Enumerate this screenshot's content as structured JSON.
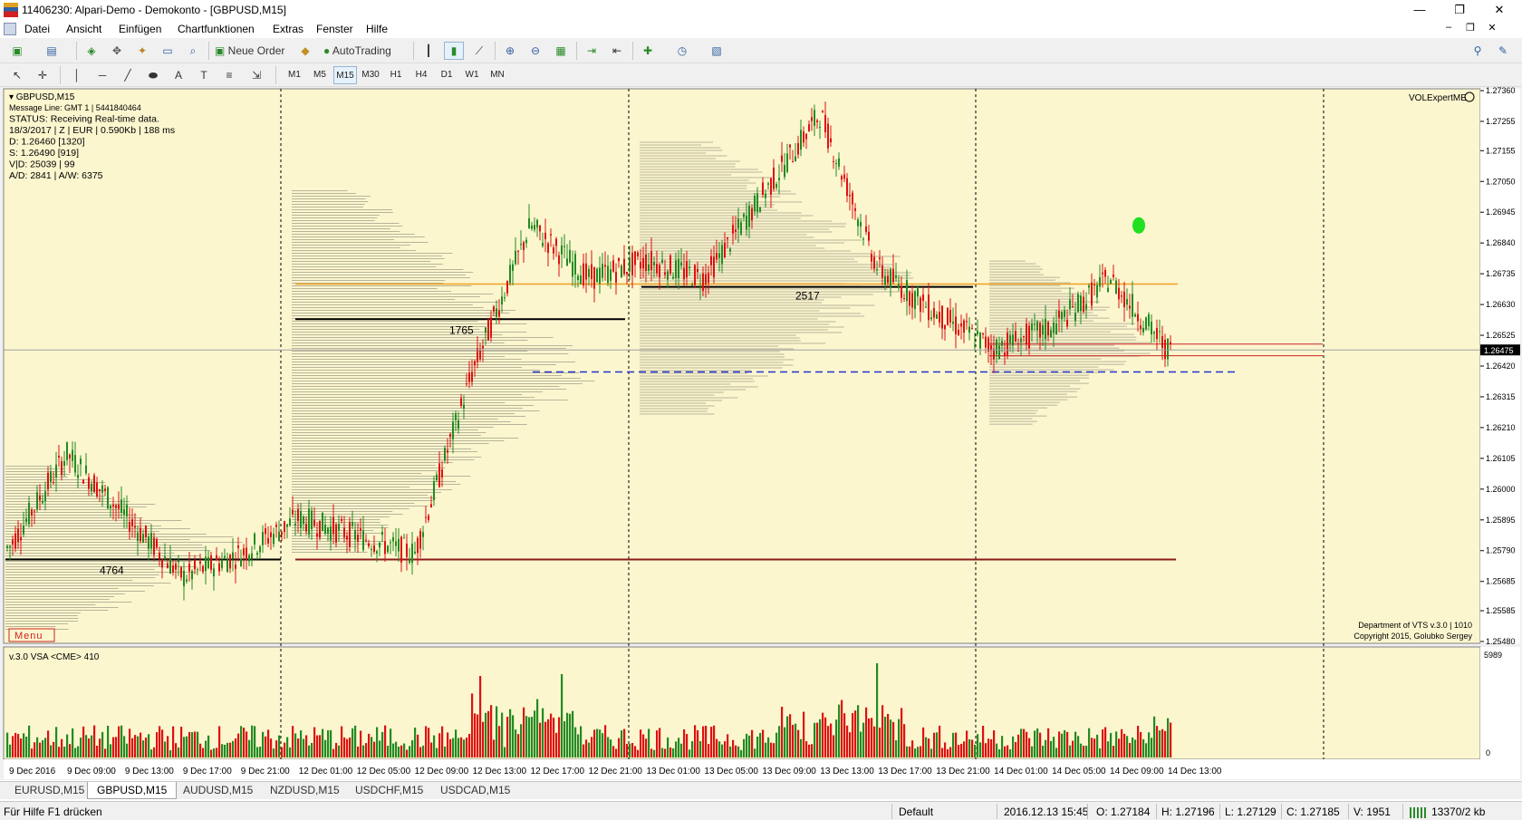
{
  "window": {
    "title": "11406230: Alpari-Demo - Demokonto - [GBPUSD,M15]",
    "minimize": "—",
    "restore": "❐",
    "close": "✕"
  },
  "menu": {
    "items": [
      "Datei",
      "Ansicht",
      "Einfügen",
      "Chartfunktionen",
      "Extras",
      "Fenster",
      "Hilfe"
    ],
    "child_min": "–",
    "child_restore": "❐",
    "child_close": "✕"
  },
  "toolbar": {
    "new_order_label": "Neue Order",
    "autotrading_label": "AutoTrading",
    "timeframes": [
      "M1",
      "M5",
      "M15",
      "M30",
      "H1",
      "H4",
      "D1",
      "W1",
      "MN"
    ],
    "selected_timeframe": "M15"
  },
  "chart": {
    "symbol_label": "▾ GBPUSD,M15",
    "info_lines": [
      "Message Line: GMT 1  |  5441840464",
      "STATUS:  Receiving Real-time data.",
      "18/3/2017 | Z | EUR | 0.590Kb | 188 ms",
      "D: 1.26460  [1320]",
      "S: 1.26490  [919]",
      "V|D: 25039 | 99",
      "A/D: 2841 | A/W: 6375"
    ],
    "expert_label": "VOLExpertME",
    "menu_button": "Menu",
    "copyright_1": "Department of VTS  v.3.0 | 1010",
    "copyright_2": "Copyright 2015, Golubko Sergey",
    "current_price": "1.26475",
    "level_labels": [
      "4764",
      "1765",
      "2517"
    ],
    "colors": {
      "background": "#fcf6cf",
      "bull": "#228b22",
      "bear": "#dd1111",
      "vpoc": "#000000",
      "orange_level": "#f0a020",
      "blue_dashed": "#2233cc",
      "dark_red_level": "#8b1a1a"
    }
  },
  "volume_pane": {
    "label": "v.3.0 VSA <CME> 410",
    "max_label": "5989",
    "zero_label": "0"
  },
  "chart_data": {
    "type": "candlestick",
    "symbol": "GBPUSD",
    "timeframe": "M15",
    "price_axis_ticks": [
      "1.27360",
      "1.27255",
      "1.27155",
      "1.27050",
      "1.26945",
      "1.26840",
      "1.26735",
      "1.26630",
      "1.26525",
      "1.26420",
      "1.26315",
      "1.26210",
      "1.26105",
      "1.26000",
      "1.25895",
      "1.25790",
      "1.25685",
      "1.25585",
      "1.25480"
    ],
    "time_axis_ticks": [
      "9 Dec 2016",
      "9 Dec 09:00",
      "9 Dec 13:00",
      "9 Dec 17:00",
      "9 Dec 21:00",
      "12 Dec 01:00",
      "12 Dec 05:00",
      "12 Dec 09:00",
      "12 Dec 13:00",
      "12 Dec 17:00",
      "12 Dec 21:00",
      "13 Dec 01:00",
      "13 Dec 05:00",
      "13 Dec 09:00",
      "13 Dec 13:00",
      "13 Dec 17:00",
      "13 Dec 21:00",
      "14 Dec 01:00",
      "14 Dec 05:00",
      "14 Dec 09:00",
      "14 Dec 13:00"
    ],
    "ylim": [
      1.2548,
      1.2736
    ],
    "current_price": 1.26475,
    "levels": [
      {
        "price": 1.2576,
        "label": "4764",
        "color": "#000000"
      },
      {
        "price": 1.2658,
        "label": "1765",
        "color": "#000000"
      },
      {
        "price": 1.2669,
        "label": "2517",
        "color": "#000000"
      },
      {
        "price": 1.267,
        "label": "",
        "color": "#f0a020"
      },
      {
        "price": 1.264,
        "label": "",
        "color": "#2233cc"
      },
      {
        "price": 1.2576,
        "label": "",
        "color": "#8b1a1a"
      }
    ],
    "key_points": [
      {
        "time": "9 Dec 2016",
        "price": 1.258
      },
      {
        "time": "9 Dec 09:00",
        "price": 1.2612
      },
      {
        "time": "9 Dec 17:00",
        "price": 1.257
      },
      {
        "time": "9 Dec 21:00",
        "price": 1.2578
      },
      {
        "time": "12 Dec 01:00",
        "price": 1.259
      },
      {
        "time": "12 Dec 09:00",
        "price": 1.2578
      },
      {
        "time": "12 Dec 13:00",
        "price": 1.264
      },
      {
        "time": "12 Dec 17:00",
        "price": 1.269
      },
      {
        "time": "12 Dec 21:00",
        "price": 1.2672
      },
      {
        "time": "13 Dec 01:00",
        "price": 1.2678
      },
      {
        "time": "13 Dec 05:00",
        "price": 1.2672
      },
      {
        "time": "13 Dec 09:00",
        "price": 1.27
      },
      {
        "time": "13 Dec 13:00",
        "price": 1.2728
      },
      {
        "time": "13 Dec 17:00",
        "price": 1.2675
      },
      {
        "time": "13 Dec 21:00",
        "price": 1.266
      },
      {
        "time": "14 Dec 01:00",
        "price": 1.2648
      },
      {
        "time": "14 Dec 05:00",
        "price": 1.2655
      },
      {
        "time": "14 Dec 09:00",
        "price": 1.2672
      },
      {
        "time": "14 Dec 13:00",
        "price": 1.26475
      }
    ]
  },
  "tabs": {
    "items": [
      "EURUSD,M15",
      "GBPUSD,M15",
      "AUDUSD,M15",
      "NZDUSD,M15",
      "USDCHF,M15",
      "USDCAD,M15"
    ],
    "active": "GBPUSD,M15"
  },
  "status": {
    "help": "Für Hilfe F1 drücken",
    "profile": "Default",
    "datetime": "2016.12.13 15:45",
    "open": "O: 1.27184",
    "high": "H: 1.27196",
    "low": "L: 1.27129",
    "close": "C: 1.27185",
    "volume": "V: 1951",
    "connection": "13370/2 kb"
  }
}
